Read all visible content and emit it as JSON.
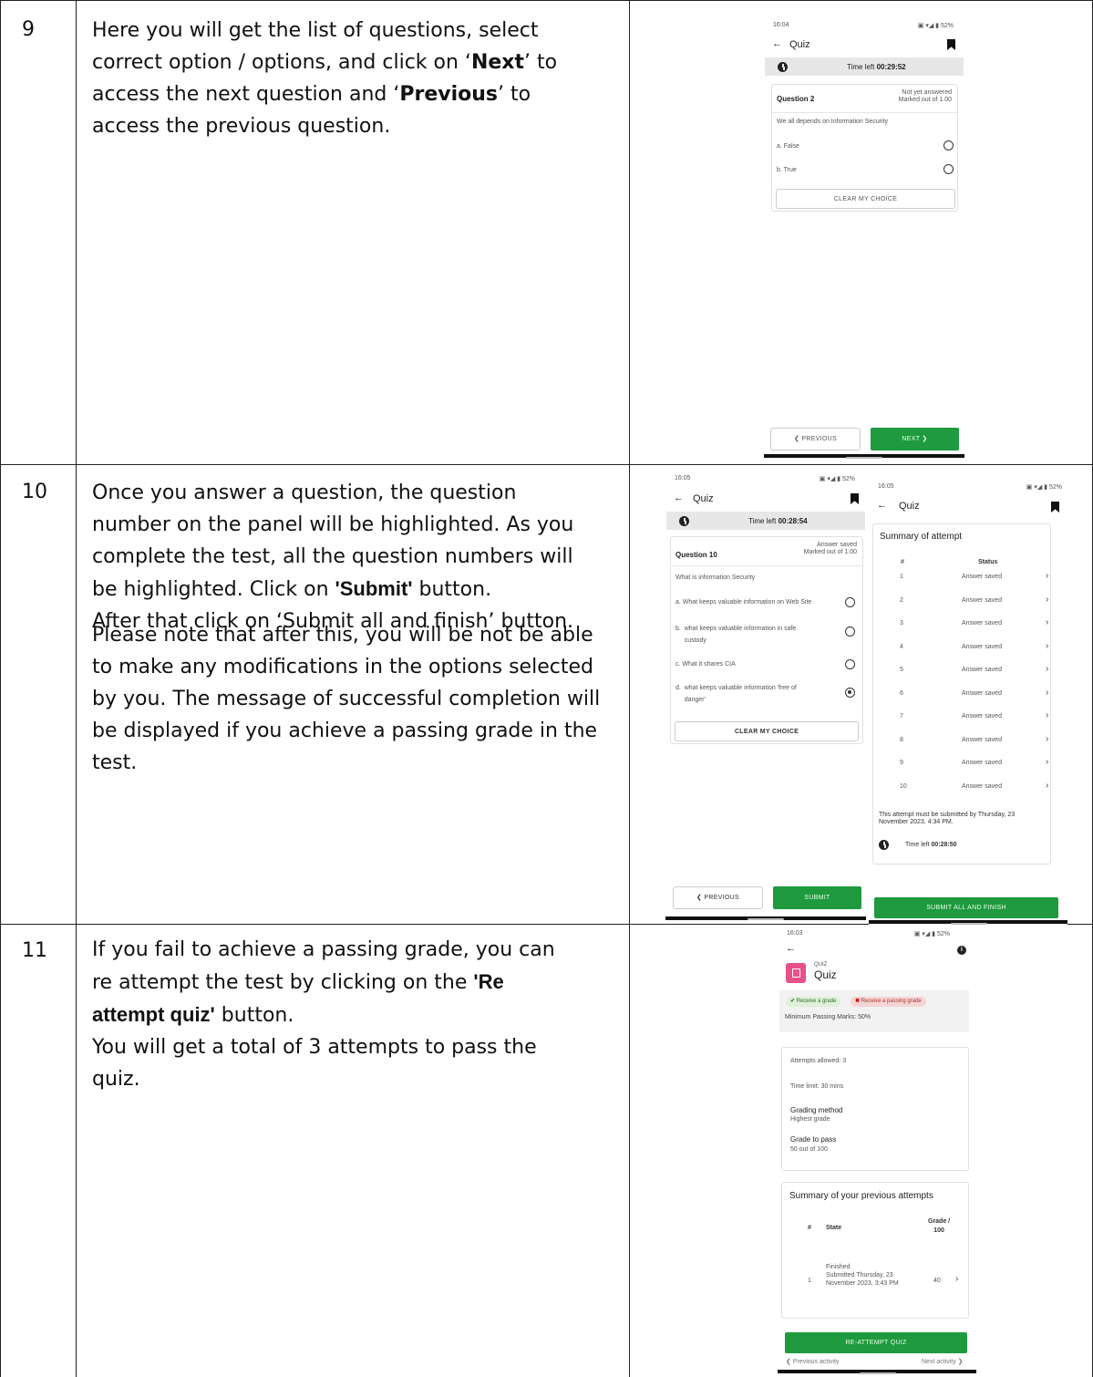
{
  "rows": [
    {
      "number": "9",
      "text_parts": [
        "Here you will get the list of questions, select\ncorrect option / options, and click on ‘",
        "Next",
        "’ to\naccess the next question and ‘",
        "Previous",
        "’ to\naccess the previous question."
      ]
    },
    {
      "number": "10",
      "line1": "Once you answer a question, the question\nnumber on the panel will be highlighted. As you\ncomplete the test, all the question numbers will\nbe highlighted. Click on ",
      "submit": "'Submit'",
      "line1_end": " button.",
      "line2a": "After that click on ",
      "line2b": "‘Submit all and finish",
      "line2c": "’ button.",
      "line3": "Please note that after this, you will be not be able\nto make any modifications in the options selected\nby you. The message of successful completion will\nbe displayed if you achieve a passing grade in the\ntest."
    },
    {
      "number": "11",
      "line1": "If you fail to achieve a passing grade, you can\nre attempt the test by clicking on the ",
      "reattempt": "'Re\nattempt quiz'",
      "line1_end": " button.",
      "line2": "You will get a total of 3 attempts to pass the\nquiz."
    }
  ],
  "s1": {
    "time": "16:04",
    "battery": "52%",
    "title": "Quiz",
    "timer_label": "Time left ",
    "timer_value": "00:29:52",
    "question": "Question 2",
    "status1": "Not yet answered",
    "status2": "Marked out of 1.00",
    "prompt": "We all depends on Information Security",
    "options": [
      "a.  False",
      "b.  True"
    ],
    "clear": "CLEAR MY CHOICE",
    "prev": "PREVIOUS",
    "next": "NEXT"
  },
  "s2": {
    "time": "16:05",
    "battery": "52%",
    "title": "Quiz",
    "timer_label": "Time left ",
    "timer_value": "00:28:54",
    "question": "Question 10",
    "status1": "Answer saved",
    "status2": "Marked out of 1.00",
    "prompt": "What is information Security",
    "options": [
      "a.  What keeps valuable information on Web Site",
      "b.  what keeps valuable information in safe\n     custody",
      "c.  What it shares CIA",
      "d.  what keeps valuable information 'free of\n     danger'"
    ],
    "clear": "CLEAR MY CHOICE",
    "prev": "PREVIOUS",
    "submit": "SUBMIT"
  },
  "s3": {
    "time": "16:05",
    "battery": "52%",
    "title": "Quiz",
    "summary": "Summary of attempt",
    "col_num": "#",
    "col_status": "Status",
    "rows": [
      {
        "n": "1",
        "s": "Answer saved"
      },
      {
        "n": "2",
        "s": "Answer saved"
      },
      {
        "n": "3",
        "s": "Answer saved"
      },
      {
        "n": "4",
        "s": "Answer saved"
      },
      {
        "n": "5",
        "s": "Answer saved"
      },
      {
        "n": "6",
        "s": "Answer saved"
      },
      {
        "n": "7",
        "s": "Answer saved"
      },
      {
        "n": "8",
        "s": "Answer saved"
      },
      {
        "n": "9",
        "s": "Answer saved"
      },
      {
        "n": "10",
        "s": "Answer saved"
      }
    ],
    "deadline": "This attempt must be submitted by Thursday, 23\nNovember 2023, 4:34 PM.",
    "timer_label": "Time left ",
    "timer_value": "00:28:50",
    "finish": "SUBMIT ALL AND FINISH"
  },
  "s4": {
    "time": "16:03",
    "battery": "52%",
    "kicker": "QUIZ",
    "title": "Quiz",
    "badge_ok": "Receive a grade",
    "badge_fail": "Receive a passing grade",
    "min_pass": "Minimum Passing Marks: 50%",
    "attempts": "Attempts allowed: 3",
    "time_limit": "Time limit: 30 mins",
    "grading_label": "Grading method",
    "grading_value": "Highest grade",
    "pass_label": "Grade to pass",
    "pass_value": "50 out of 100",
    "prev_title": "Summary of your previous attempts",
    "col_num": "#",
    "col_state": "State",
    "col_grade": "Grade /\n100",
    "attempt_num": "1",
    "attempt_state": "Finished\nSubmitted Thursday, 23\nNovember 2023, 3:43 PM",
    "attempt_grade": "40",
    "reattempt": "RE-ATTEMPT QUIZ",
    "prev_activity": "Previous activity",
    "next_activity": "Next activity"
  }
}
